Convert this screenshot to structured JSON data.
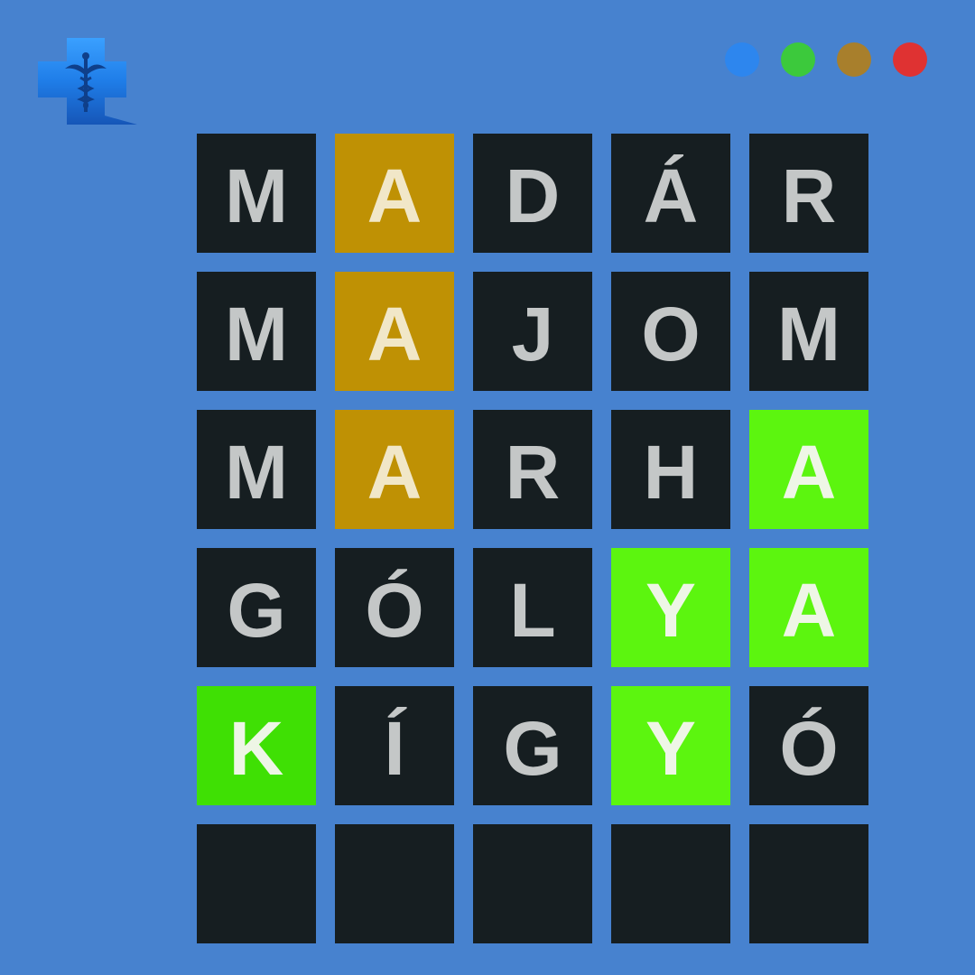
{
  "colors": {
    "background": "#4782cf",
    "tile_absent": "#161e21",
    "tile_present": "#bf9104",
    "tile_correct": "#5cf50f",
    "letter_absent": "#c4c7c7",
    "letter_highlight": "#f1eee0"
  },
  "logo": {
    "icon": "medical-cross-caduceus-icon"
  },
  "window_dots": [
    {
      "name": "blue-dot",
      "color": "#2d86ee"
    },
    {
      "name": "green-dot",
      "color": "#3cc93c"
    },
    {
      "name": "brown-dot",
      "color": "#a87f2c"
    },
    {
      "name": "red-dot",
      "color": "#df3232"
    }
  ],
  "board": {
    "rows": [
      {
        "tiles": [
          {
            "letter": "M",
            "state": "absent"
          },
          {
            "letter": "A",
            "state": "present"
          },
          {
            "letter": "D",
            "state": "absent"
          },
          {
            "letter": "Á",
            "state": "absent"
          },
          {
            "letter": "R",
            "state": "absent"
          }
        ]
      },
      {
        "tiles": [
          {
            "letter": "M",
            "state": "absent"
          },
          {
            "letter": "A",
            "state": "present"
          },
          {
            "letter": "J",
            "state": "absent"
          },
          {
            "letter": "O",
            "state": "absent"
          },
          {
            "letter": "M",
            "state": "absent"
          }
        ]
      },
      {
        "tiles": [
          {
            "letter": "M",
            "state": "absent"
          },
          {
            "letter": "A",
            "state": "present"
          },
          {
            "letter": "R",
            "state": "absent"
          },
          {
            "letter": "H",
            "state": "absent"
          },
          {
            "letter": "A",
            "state": "correct"
          }
        ]
      },
      {
        "tiles": [
          {
            "letter": "G",
            "state": "absent"
          },
          {
            "letter": "Ó",
            "state": "absent"
          },
          {
            "letter": "L",
            "state": "absent"
          },
          {
            "letter": "Y",
            "state": "correct"
          },
          {
            "letter": "A",
            "state": "correct"
          }
        ]
      },
      {
        "tiles": [
          {
            "letter": "K",
            "state": "correct-k"
          },
          {
            "letter": "Í",
            "state": "absent"
          },
          {
            "letter": "G",
            "state": "absent"
          },
          {
            "letter": "Y",
            "state": "correct"
          },
          {
            "letter": "Ó",
            "state": "absent"
          }
        ]
      },
      {
        "tiles": [
          {
            "letter": "",
            "state": "empty"
          },
          {
            "letter": "",
            "state": "empty"
          },
          {
            "letter": "",
            "state": "empty"
          },
          {
            "letter": "",
            "state": "empty"
          },
          {
            "letter": "",
            "state": "empty"
          }
        ]
      }
    ]
  }
}
